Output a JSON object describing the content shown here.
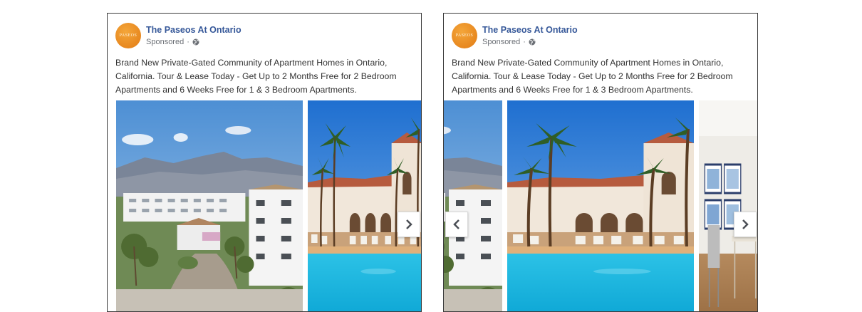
{
  "ads": [
    {
      "page_name": "The Paseos At Ontario",
      "avatar_text": "PASEOS",
      "sponsored_label": "Sponsored",
      "body": "Brand New Private-Gated Community of Apartment Homes in Ontario, California. Tour & Lease Today - Get Up to 2 Months Free for 2 Bedroom Apartments and 6 Weeks Free for 1 & 3 Bedroom Apartments."
    },
    {
      "page_name": "The Paseos At Ontario",
      "avatar_text": "PASEOS",
      "sponsored_label": "Sponsored",
      "body": "Brand New Private-Gated Community of Apartment Homes in Ontario, California. Tour & Lease Today - Get Up to 2 Months Free for 2 Bedroom Apartments and 6 Weeks Free for 1 & 3 Bedroom Apartments."
    }
  ],
  "icons": {
    "globe": "globe-icon",
    "next": "chevron-right-icon",
    "prev": "chevron-left-icon"
  },
  "colors": {
    "page_name": "#365899",
    "avatar": "#e8891e",
    "border": "#3b3b3b"
  }
}
